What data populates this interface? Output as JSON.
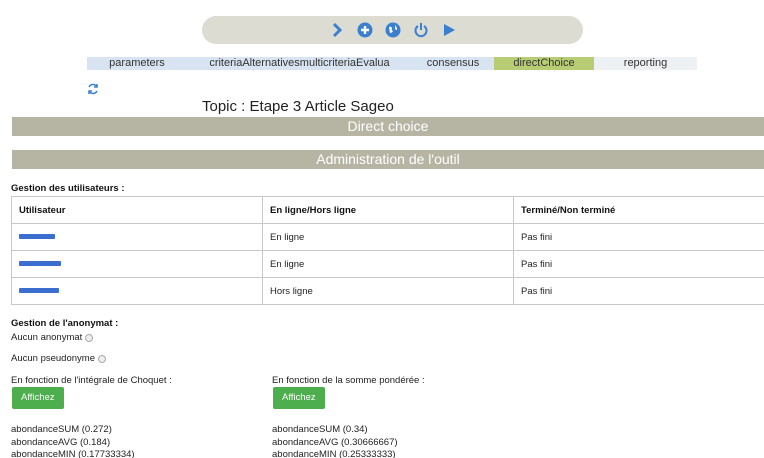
{
  "toolbar": {
    "icons": [
      "chevron-right-icon",
      "plus-circle-icon",
      "globe-icon",
      "power-icon",
      "play-icon"
    ],
    "color": "#3a7fd0"
  },
  "tabs": [
    {
      "label": "parameters",
      "state": "normal"
    },
    {
      "label": "criteriaAlternativesmulticriteriaEvalua",
      "state": "normal"
    },
    {
      "label": "consensus",
      "state": "normal"
    },
    {
      "label": "directChoice",
      "state": "active"
    },
    {
      "label": "reporting",
      "state": "plain"
    }
  ],
  "topic": "Topic : Etape 3 Article Sageo",
  "banners": {
    "direct_choice": "Direct choice",
    "administration": "Administration de l'outil"
  },
  "users_section": {
    "title": "Gestion des utilisateurs :",
    "columns": [
      "Utilisateur",
      "En ligne/Hors ligne",
      "Terminé/Non terminé"
    ],
    "rows": [
      {
        "user_redacted": true,
        "status": "En ligne",
        "done": "Pas fini"
      },
      {
        "user_redacted": true,
        "status": "En ligne",
        "done": "Pas fini"
      },
      {
        "user_redacted": true,
        "status": "Hors ligne",
        "done": "Pas fini"
      }
    ]
  },
  "anonymity": {
    "title": "Gestion de l'anonymat :",
    "options": [
      "Aucun anonymat",
      "Aucun pseudonyme"
    ]
  },
  "choquet": {
    "label": "En fonction de l'intégrale de Choquet :",
    "button": "Affichez",
    "results": [
      "abondanceSUM (0.272)",
      "abondanceAVG (0.184)",
      "abondanceMIN (0.17733334)"
    ]
  },
  "weighted": {
    "label": "En fonction de la somme pondérée :",
    "button": "Affichez",
    "results": [
      "abondanceSUM (0.34)",
      "abondanceAVG (0.30666667)",
      "abondanceMIN (0.25333333)"
    ]
  },
  "colors": {
    "banner": "#b6b5a4",
    "tab_active": "#b8cc74",
    "tab_normal": "#d8e4f2",
    "button_green": "#4cae4c",
    "redaction": "#3a6fd0"
  }
}
